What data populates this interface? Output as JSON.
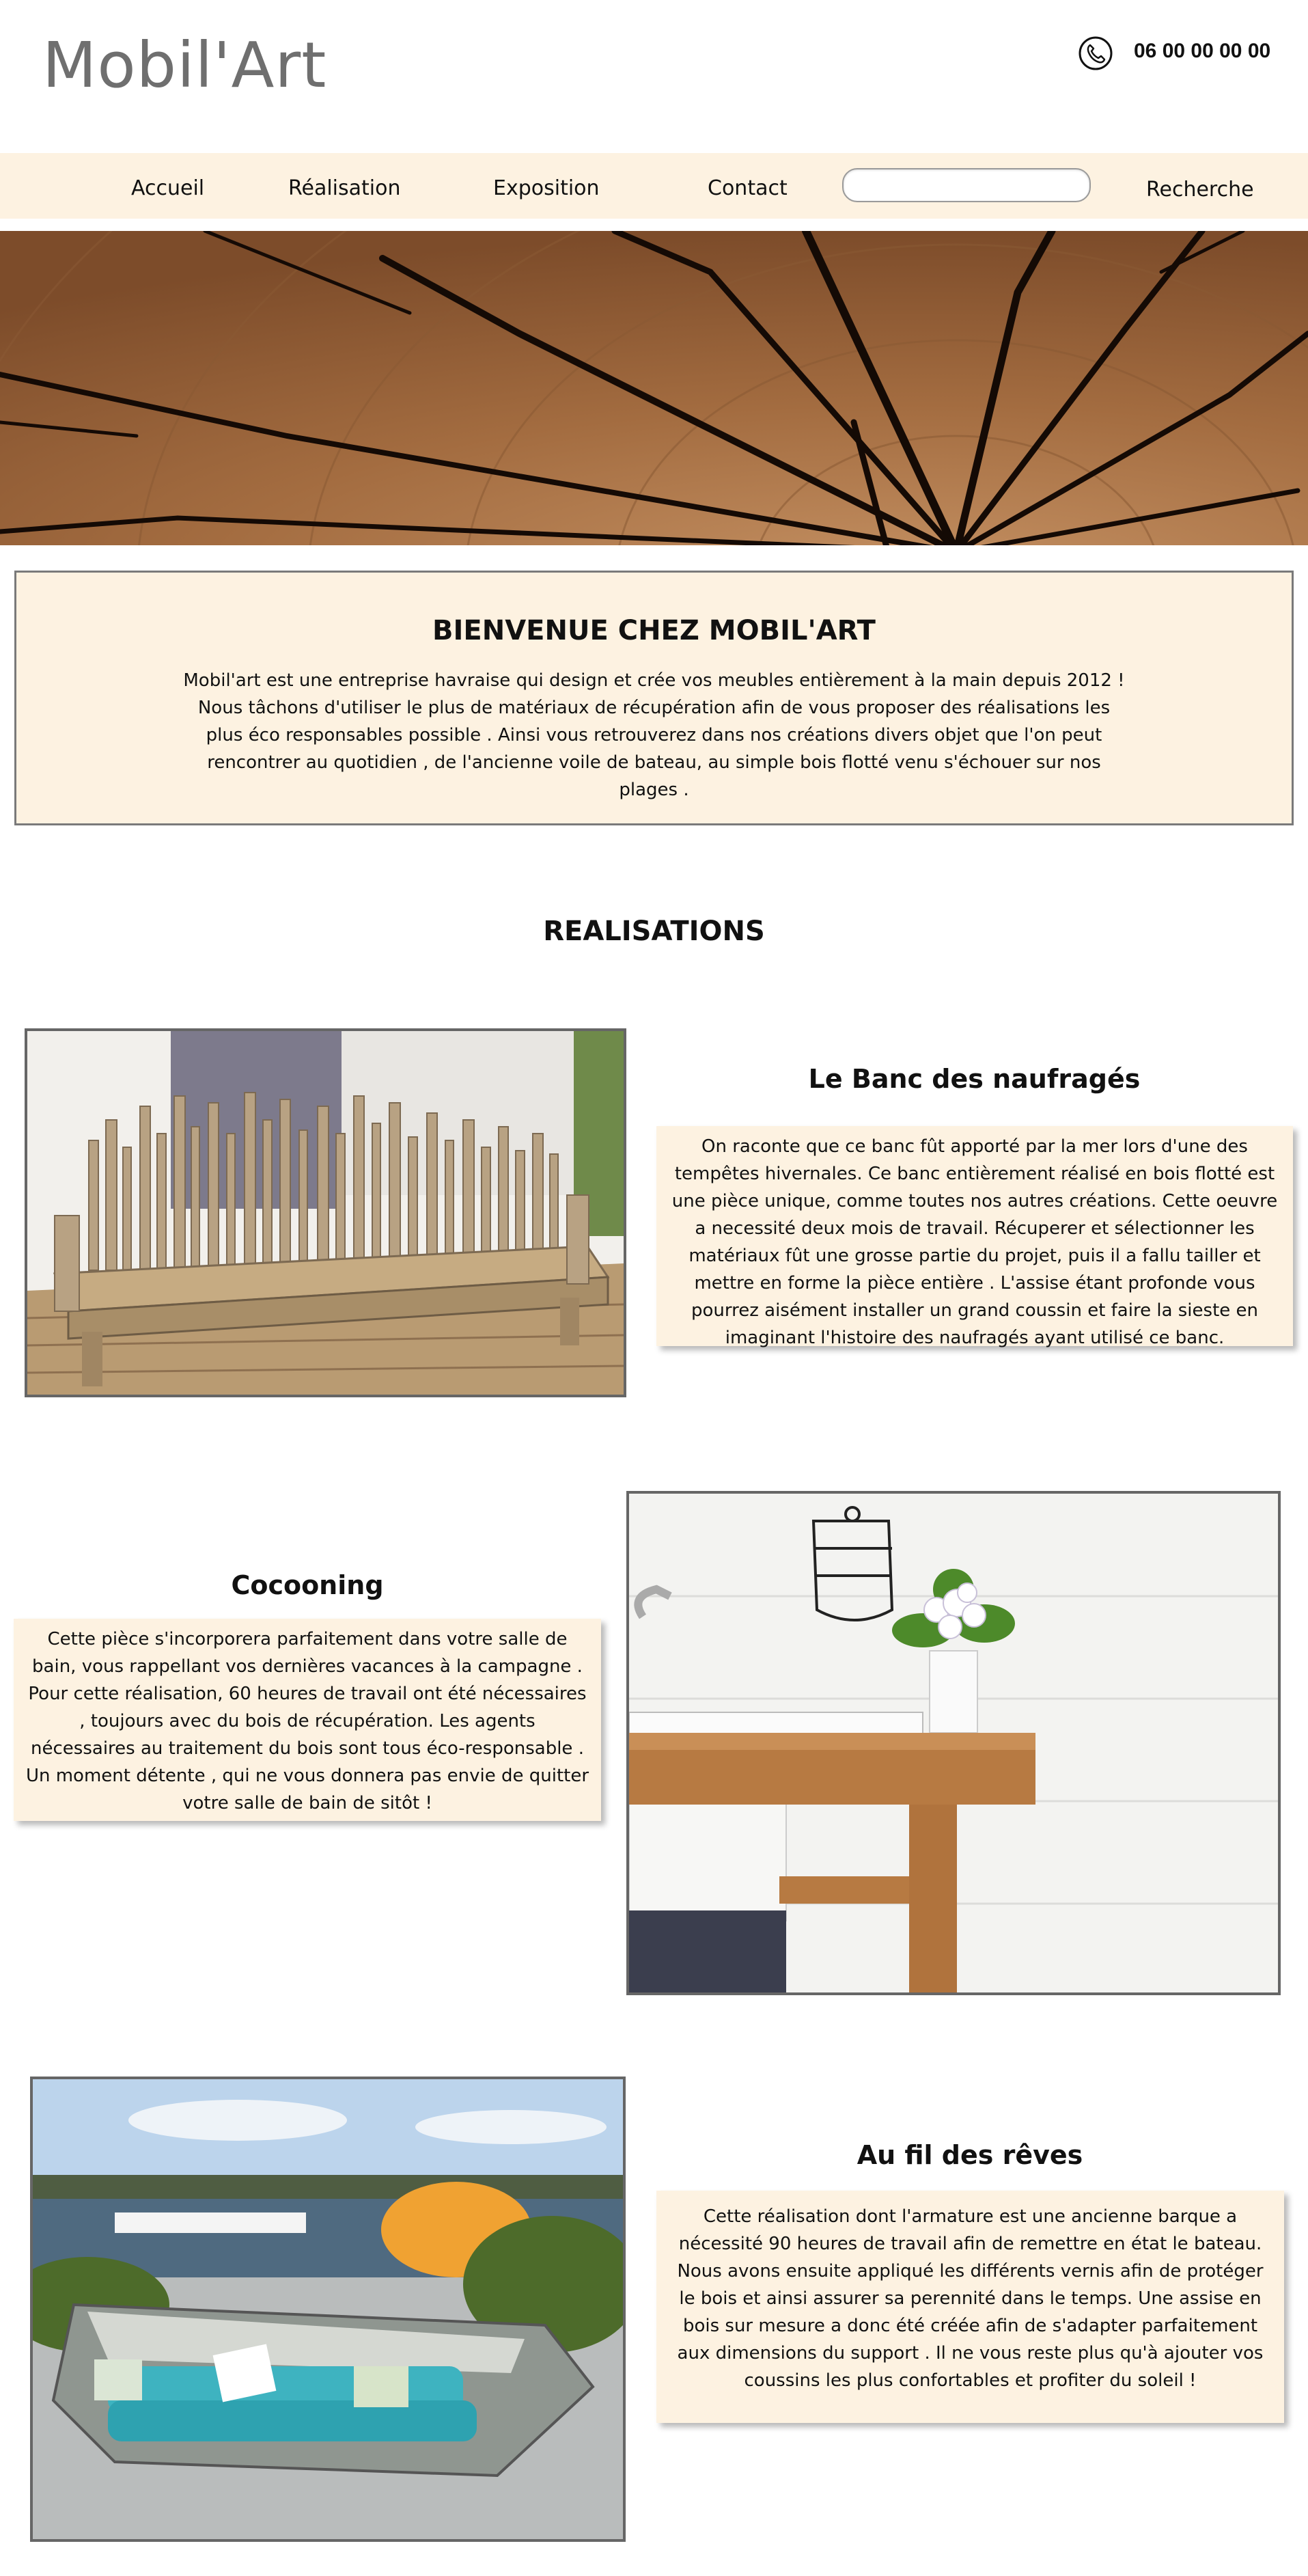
{
  "header": {
    "logo": "Mobil'Art",
    "phone": "06 00 00 00 00",
    "phone_icon": "phone-icon"
  },
  "nav": {
    "items": [
      "Accueil",
      "Réalisation",
      "Exposition",
      "Contact"
    ],
    "search_placeholder": "",
    "search_label": "Recherche"
  },
  "welcome": {
    "title": "BIENVENUE CHEZ MOBIL'ART",
    "text": "Mobil'art est une entreprise havraise qui design et crée vos meubles entièrement à la main depuis 2012 ! Nous tâchons d'utiliser le plus de matériaux de récupération afin de vous proposer des réalisations les plus éco responsables possible . Ainsi vous retrouverez dans nos créations divers objet que l'on peut rencontrer au quotidien , de l'ancienne voile de bateau, au simple bois flotté venu s'échouer sur nos plages ."
  },
  "realisations": {
    "title": "REALISATIONS",
    "items": [
      {
        "title": "Le Banc des naufragés",
        "text": "On raconte que ce banc fût apporté par la mer lors d'une des tempêtes hivernales. Ce banc entièrement réalisé en bois flotté est une pièce unique, comme toutes nos autres créations. Cette oeuvre a necessité deux mois de travail. Récuperer et sélectionner les matériaux fût une grosse partie du projet, puis il a fallu tailler et mettre en forme la pièce entière . L'assise étant profonde vous pourrez aisément installer un grand coussin et faire la sieste en imaginant l'histoire des naufragés ayant utilisé ce banc."
      },
      {
        "title": "Cocooning",
        "text": "Cette pièce s'incorporera parfaitement dans votre salle de bain, vous rappellant vos dernières vacances à la campagne . Pour cette réalisation, 60 heures de travail ont été nécessaires , toujours avec du bois de récupération. Les agents nécessaires au traitement du bois sont tous éco-responsable . Un moment détente , qui ne vous donnera pas envie de quitter votre salle de bain de sitôt !"
      },
      {
        "title": "Au fil des rêves",
        "text": "Cette réalisation dont l'armature est une ancienne barque a nécessité 90 heures de travail afin de remettre en état le bateau. Nous avons ensuite appliqué les différents vernis afin de protéger le bois et ainsi assurer sa perennité dans le temps. Une assise en bois sur mesure a donc été créée afin de s'adapter parfaitement aux dimensions du support . Il ne vous reste plus qu'à ajouter vos coussins les plus confortables et profiter du soleil !"
      }
    ]
  },
  "colors": {
    "cream": "#fdf2e1",
    "logo_gray": "#6f6f6f",
    "border_gray": "#666666"
  }
}
